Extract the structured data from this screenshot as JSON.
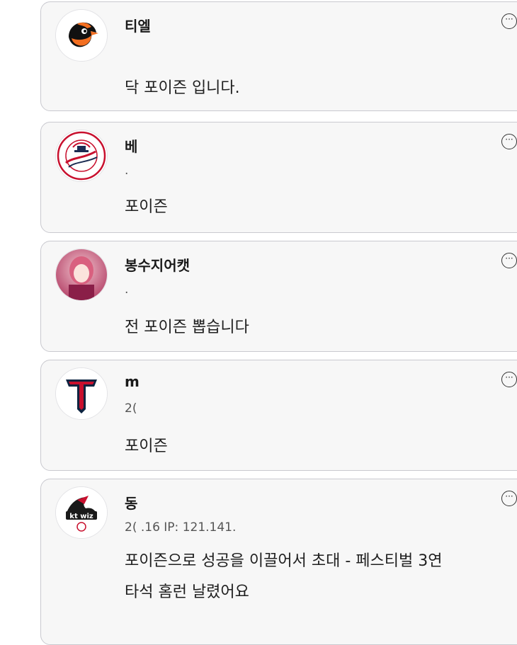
{
  "comments": [
    {
      "username": "티엘",
      "meta": "",
      "text_lines": [
        "닥 포이즌 입니다."
      ],
      "avatar": "orioles-bird-icon"
    },
    {
      "username": "베",
      "meta": ".",
      "text_lines": [
        "포이즌"
      ],
      "avatar": "yankees-logo-icon"
    },
    {
      "username": "봉수지어캣",
      "meta": ".",
      "text_lines": [
        "전 포이즌 뽑습니다"
      ],
      "avatar": "profile-photo"
    },
    {
      "username": "m",
      "meta": "2(",
      "text_lines": [
        "포이즌"
      ],
      "avatar": "t-shield-logo-icon"
    },
    {
      "username": "동",
      "meta": "2( .16 IP: 121.141.",
      "text_lines": [
        "포이즌으로 성공을 이끌어서 초대 - 페스티벌 3연",
        "타석 홈런 날렸어요"
      ],
      "avatar": "kt-wiz-logo-icon"
    }
  ],
  "logo_text": {
    "kt": "kt wiz"
  },
  "more_icon_glyph": "···",
  "colors": {
    "card_bg": "#f7f7f7",
    "card_border": "#c9c9cf",
    "orioles_orange": "#f36f21",
    "yankees_navy": "#1c2c52",
    "yankees_red": "#c8102e",
    "t_red": "#c8102e",
    "t_navy": "#0c2340",
    "kt_black": "#1a1a1a"
  }
}
